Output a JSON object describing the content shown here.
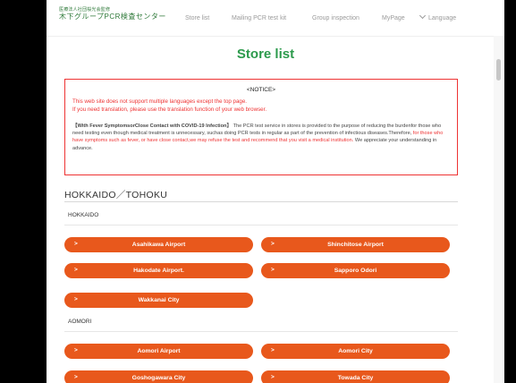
{
  "header": {
    "logo_small": "医療法人社団桜光会監修",
    "logo_big": "木下グループPCR検査センター",
    "nav": {
      "store_list": "Store list",
      "mailing": "Mailing PCR test kit",
      "group": "Group inspection",
      "mypage": "MyPage",
      "language": "Language"
    }
  },
  "page": {
    "title": "Store list"
  },
  "notice": {
    "title": "<NOTICE>",
    "line1": "This web site does not support multiple languages except the top page.",
    "line2": "If you need translation, please use the translation function of your web browser.",
    "body_bold": "【With Fever SymptomsorClose Contact with COVID-19 Infection】",
    "body_part1": " The PCR test service in stores is provided to the purpose of reducing the burdenfor those who need testing even though medical treatment is unnecessary, suchas doing PCR tests in regular as part of the prevention of infectious diseases.Therefore, ",
    "body_red": "for those who have symptoms such as fever, or have close contact,we may refuse the test and recommend that you visit a medical institution.",
    "body_part2": " We appreciate your understanding in advance."
  },
  "region": {
    "name": "HOKKAIDO／TOHOKU",
    "prefectures": [
      {
        "name": "HOKKAIDO",
        "stores": [
          "Asahikawa Airport",
          "Shinchitose Airport",
          "Hakodate Airport.",
          "Sapporo Odori",
          "Wakkanai City"
        ]
      },
      {
        "name": "AOMORI",
        "stores": [
          "Aomori Airport",
          "Aomori City",
          "Goshogawara City",
          "Towada City"
        ]
      }
    ]
  },
  "button_chevron": ">",
  "colors": {
    "accent_green": "#2c9a4c",
    "button_orange": "#e8581c",
    "notice_red": "#e33333"
  }
}
